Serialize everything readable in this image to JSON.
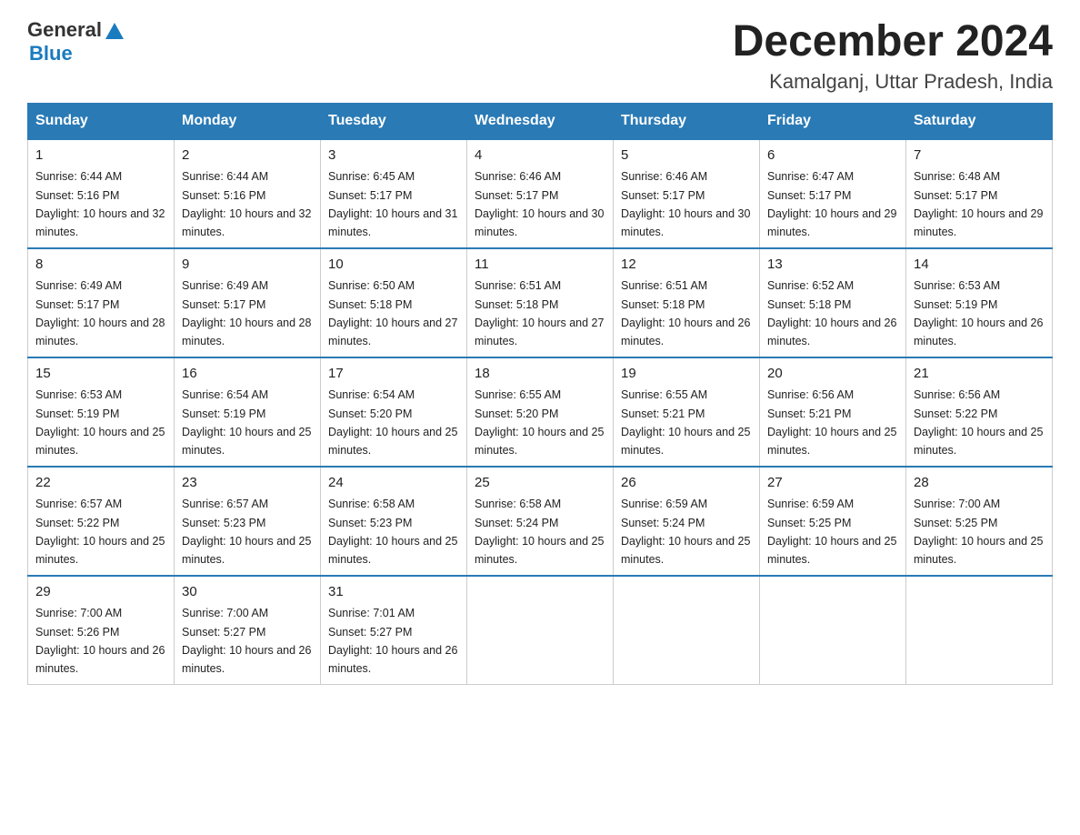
{
  "logo": {
    "text_general": "General",
    "text_blue": "Blue"
  },
  "header": {
    "month_year": "December 2024",
    "location": "Kamalganj, Uttar Pradesh, India"
  },
  "weekdays": [
    "Sunday",
    "Monday",
    "Tuesday",
    "Wednesday",
    "Thursday",
    "Friday",
    "Saturday"
  ],
  "weeks": [
    [
      {
        "day": "1",
        "sunrise": "6:44 AM",
        "sunset": "5:16 PM",
        "daylight": "10 hours and 32 minutes."
      },
      {
        "day": "2",
        "sunrise": "6:44 AM",
        "sunset": "5:16 PM",
        "daylight": "10 hours and 32 minutes."
      },
      {
        "day": "3",
        "sunrise": "6:45 AM",
        "sunset": "5:17 PM",
        "daylight": "10 hours and 31 minutes."
      },
      {
        "day": "4",
        "sunrise": "6:46 AM",
        "sunset": "5:17 PM",
        "daylight": "10 hours and 30 minutes."
      },
      {
        "day": "5",
        "sunrise": "6:46 AM",
        "sunset": "5:17 PM",
        "daylight": "10 hours and 30 minutes."
      },
      {
        "day": "6",
        "sunrise": "6:47 AM",
        "sunset": "5:17 PM",
        "daylight": "10 hours and 29 minutes."
      },
      {
        "day": "7",
        "sunrise": "6:48 AM",
        "sunset": "5:17 PM",
        "daylight": "10 hours and 29 minutes."
      }
    ],
    [
      {
        "day": "8",
        "sunrise": "6:49 AM",
        "sunset": "5:17 PM",
        "daylight": "10 hours and 28 minutes."
      },
      {
        "day": "9",
        "sunrise": "6:49 AM",
        "sunset": "5:17 PM",
        "daylight": "10 hours and 28 minutes."
      },
      {
        "day": "10",
        "sunrise": "6:50 AM",
        "sunset": "5:18 PM",
        "daylight": "10 hours and 27 minutes."
      },
      {
        "day": "11",
        "sunrise": "6:51 AM",
        "sunset": "5:18 PM",
        "daylight": "10 hours and 27 minutes."
      },
      {
        "day": "12",
        "sunrise": "6:51 AM",
        "sunset": "5:18 PM",
        "daylight": "10 hours and 26 minutes."
      },
      {
        "day": "13",
        "sunrise": "6:52 AM",
        "sunset": "5:18 PM",
        "daylight": "10 hours and 26 minutes."
      },
      {
        "day": "14",
        "sunrise": "6:53 AM",
        "sunset": "5:19 PM",
        "daylight": "10 hours and 26 minutes."
      }
    ],
    [
      {
        "day": "15",
        "sunrise": "6:53 AM",
        "sunset": "5:19 PM",
        "daylight": "10 hours and 25 minutes."
      },
      {
        "day": "16",
        "sunrise": "6:54 AM",
        "sunset": "5:19 PM",
        "daylight": "10 hours and 25 minutes."
      },
      {
        "day": "17",
        "sunrise": "6:54 AM",
        "sunset": "5:20 PM",
        "daylight": "10 hours and 25 minutes."
      },
      {
        "day": "18",
        "sunrise": "6:55 AM",
        "sunset": "5:20 PM",
        "daylight": "10 hours and 25 minutes."
      },
      {
        "day": "19",
        "sunrise": "6:55 AM",
        "sunset": "5:21 PM",
        "daylight": "10 hours and 25 minutes."
      },
      {
        "day": "20",
        "sunrise": "6:56 AM",
        "sunset": "5:21 PM",
        "daylight": "10 hours and 25 minutes."
      },
      {
        "day": "21",
        "sunrise": "6:56 AM",
        "sunset": "5:22 PM",
        "daylight": "10 hours and 25 minutes."
      }
    ],
    [
      {
        "day": "22",
        "sunrise": "6:57 AM",
        "sunset": "5:22 PM",
        "daylight": "10 hours and 25 minutes."
      },
      {
        "day": "23",
        "sunrise": "6:57 AM",
        "sunset": "5:23 PM",
        "daylight": "10 hours and 25 minutes."
      },
      {
        "day": "24",
        "sunrise": "6:58 AM",
        "sunset": "5:23 PM",
        "daylight": "10 hours and 25 minutes."
      },
      {
        "day": "25",
        "sunrise": "6:58 AM",
        "sunset": "5:24 PM",
        "daylight": "10 hours and 25 minutes."
      },
      {
        "day": "26",
        "sunrise": "6:59 AM",
        "sunset": "5:24 PM",
        "daylight": "10 hours and 25 minutes."
      },
      {
        "day": "27",
        "sunrise": "6:59 AM",
        "sunset": "5:25 PM",
        "daylight": "10 hours and 25 minutes."
      },
      {
        "day": "28",
        "sunrise": "7:00 AM",
        "sunset": "5:25 PM",
        "daylight": "10 hours and 25 minutes."
      }
    ],
    [
      {
        "day": "29",
        "sunrise": "7:00 AM",
        "sunset": "5:26 PM",
        "daylight": "10 hours and 26 minutes."
      },
      {
        "day": "30",
        "sunrise": "7:00 AM",
        "sunset": "5:27 PM",
        "daylight": "10 hours and 26 minutes."
      },
      {
        "day": "31",
        "sunrise": "7:01 AM",
        "sunset": "5:27 PM",
        "daylight": "10 hours and 26 minutes."
      },
      {
        "day": "",
        "sunrise": "",
        "sunset": "",
        "daylight": ""
      },
      {
        "day": "",
        "sunrise": "",
        "sunset": "",
        "daylight": ""
      },
      {
        "day": "",
        "sunrise": "",
        "sunset": "",
        "daylight": ""
      },
      {
        "day": "",
        "sunrise": "",
        "sunset": "",
        "daylight": ""
      }
    ]
  ],
  "labels": {
    "sunrise": "Sunrise: ",
    "sunset": "Sunset: ",
    "daylight": "Daylight: "
  }
}
